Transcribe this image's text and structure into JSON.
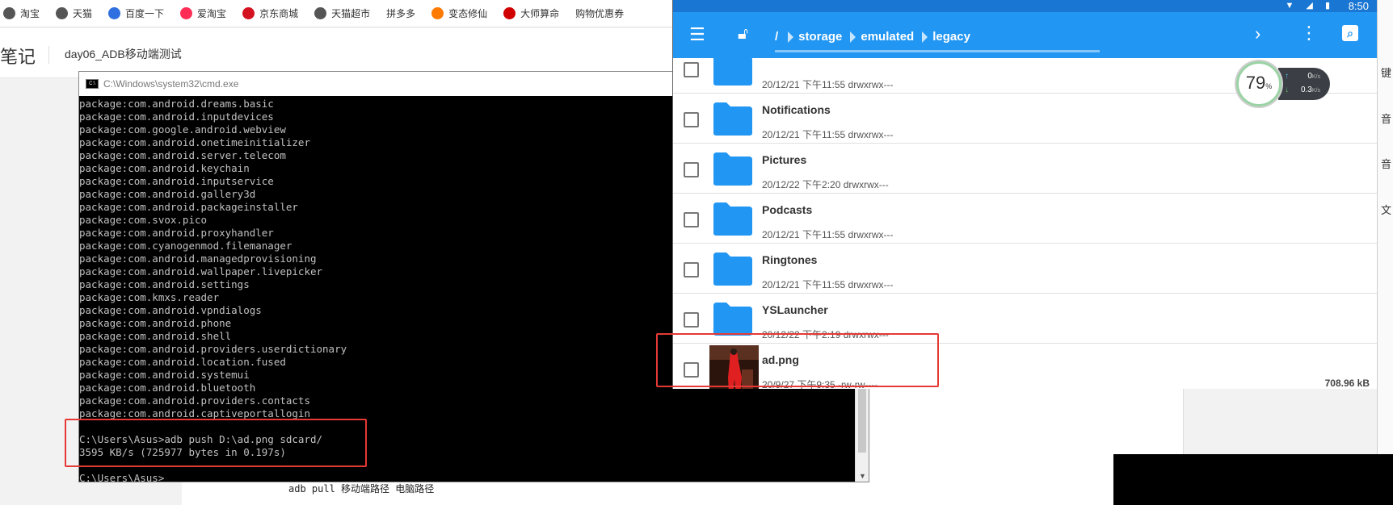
{
  "bookmarks": [
    {
      "label": "淘宝",
      "color": "#555555"
    },
    {
      "label": "天猫",
      "color": "#555555"
    },
    {
      "label": "百度一下",
      "color": "#2f6fe0"
    },
    {
      "label": "爱淘宝",
      "color": "#ff2d55"
    },
    {
      "label": "京东商城",
      "color": "#d4121f"
    },
    {
      "label": "天猫超市",
      "color": "#555555"
    },
    {
      "label": "拼多多",
      "color": ""
    },
    {
      "label": "变态修仙",
      "color": "#ff7a00"
    },
    {
      "label": "大师算命",
      "color": "#d00000"
    },
    {
      "label": "购物优惠券",
      "color": ""
    }
  ],
  "note": {
    "brand": "笔记",
    "title": "day06_ADB移动端测试",
    "cmd_line": "adb pull 移动端路径 电脑路径"
  },
  "cmd": {
    "title": "C:\\Windows\\system32\\cmd.exe",
    "lines": [
      "package:com.android.dreams.basic",
      "package:com.android.inputdevices",
      "package:com.google.android.webview",
      "package:com.android.onetimeinitializer",
      "package:com.android.server.telecom",
      "package:com.android.keychain",
      "package:com.android.inputservice",
      "package:com.android.gallery3d",
      "package:com.android.packageinstaller",
      "package:com.svox.pico",
      "package:com.android.proxyhandler",
      "package:com.cyanogenmod.filemanager",
      "package:com.android.managedprovisioning",
      "package:com.android.wallpaper.livepicker",
      "package:com.android.settings",
      "package:com.kmxs.reader",
      "package:com.android.vpndialogs",
      "package:com.android.phone",
      "package:com.android.shell",
      "package:com.android.providers.userdictionary",
      "package:com.android.location.fused",
      "package:com.android.systemui",
      "package:com.android.bluetooth",
      "package:com.android.providers.contacts",
      "package:com.android.captiveportallogin",
      "",
      "C:\\Users\\Asus>adb push D:\\ad.png sdcard/",
      "3595 KB/s (725977 bytes in 0.197s)",
      "",
      "C:\\Users\\Asus>"
    ]
  },
  "phone": {
    "time": "8:50",
    "status_icons": "▼ ◢ ▮",
    "crumbs": [
      "/",
      "storage",
      "emulated",
      "legacy"
    ],
    "icons": {
      "menu": "menu-icon",
      "lock": "lock-icon",
      "forward": "chevron-right-icon",
      "more": "more-vert-icon",
      "search": "search-icon"
    },
    "files": [
      {
        "name": "",
        "meta": "20/12/21 下午11:55   drwxrwx---",
        "type": "folder",
        "size": ""
      },
      {
        "name": "Notifications",
        "meta": "20/12/21 下午11:55   drwxrwx---",
        "type": "folder",
        "size": ""
      },
      {
        "name": "Pictures",
        "meta": "20/12/22 下午2:20   drwxrwx---",
        "type": "folder",
        "size": ""
      },
      {
        "name": "Podcasts",
        "meta": "20/12/21 下午11:55   drwxrwx---",
        "type": "folder",
        "size": ""
      },
      {
        "name": "Ringtones",
        "meta": "20/12/21 下午11:55   drwxrwx---",
        "type": "folder",
        "size": ""
      },
      {
        "name": "YSLauncher",
        "meta": "20/12/22 下午2:19   drwxrwx---",
        "type": "folder",
        "size": ""
      },
      {
        "name": "ad.png",
        "meta": "20/9/27 下午9:35   -rw-rw----",
        "type": "image",
        "size": "708.96 kB"
      }
    ],
    "folder_color": "#2196f3"
  },
  "speed_widget": {
    "percent": "79",
    "percent_unit": "%",
    "up": "0",
    "up_unit": "K/s",
    "down": "0.3",
    "down_unit": "K/s"
  },
  "edge_chars": [
    "键",
    "音",
    "音",
    "文"
  ]
}
